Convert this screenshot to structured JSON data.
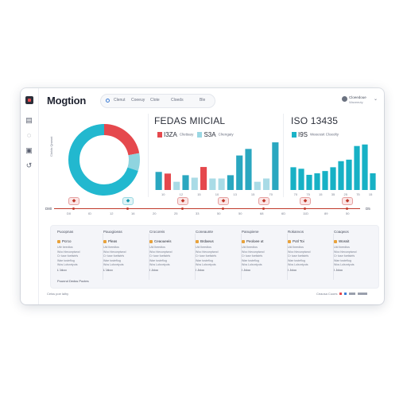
{
  "app": {
    "title": "Mogtion"
  },
  "nav": {
    "tabs": [
      "Clenut",
      "Coeeuy",
      "Clote",
      "Cloeds",
      "Ble"
    ]
  },
  "user": {
    "name": "Cloeedoue",
    "role": "Waveeuty"
  },
  "sidebar": {
    "icons": [
      "calendar-icon",
      "chat-icon",
      "list-icon",
      "link-icon"
    ]
  },
  "donut": {
    "axis_label": "Ctolds Qrawnt",
    "segments": [
      {
        "name": "main",
        "value": 70,
        "color": "#22b8cf"
      },
      {
        "name": "red",
        "value": 22,
        "color": "#e5484d"
      },
      {
        "name": "small",
        "value": 8,
        "color": "#8fd4df"
      }
    ]
  },
  "panel2": {
    "title": "FEDAS MIICIAL",
    "legend": [
      {
        "key": "I3ZA",
        "label": "Cliettauy",
        "color": "#e5484d"
      },
      {
        "key": "S3A",
        "label": "Clrengaiy",
        "color": "#9ad7e3"
      }
    ],
    "ticks": [
      "10",
      "12",
      "15",
      "10",
      "13",
      "15",
      "70"
    ]
  },
  "panel3": {
    "title": "ISO 13435",
    "legend": [
      {
        "key": "I9S",
        "label": "Weeessit Cloeolty",
        "color": "#1bb3c7"
      }
    ],
    "ticks": [
      "70",
      "75",
      "15",
      "35",
      "25",
      "75",
      "15"
    ]
  },
  "timeline": {
    "start": "D80",
    "end": "D5",
    "ticks": [
      "D0",
      "ID",
      "12",
      "16",
      "20",
      "25",
      "33",
      "50",
      "50",
      "68",
      "6D",
      "11D",
      "89",
      "50"
    ]
  },
  "cards": [
    {
      "title": "Puoopnas",
      "badge": "Pcrco",
      "lines": [
        "Uttr beedtos",
        "Woo hlecunptwod",
        "Cr tuse foetlstrfs",
        "Wae tosteflog",
        "Wos Lolsnrtyuts"
      ],
      "foot": "L'Jdoo",
      "extra": "Pounnd Dedss Poctes"
    },
    {
      "title": "Pauogioeas",
      "badge": "Pleas",
      "lines": [
        "Uld lbeedtos",
        "Woo hlecunptwod",
        "Cr tuse foetlstrfs",
        "Wae tosteflog",
        "Wos Lolsnrtyuts"
      ],
      "foot": "L'Jdoo",
      "extra": ""
    },
    {
      "title": "Crocoreis",
      "badge": "Ceaoueeis",
      "lines": [
        "Uld lbeedtos",
        "Woo hlecunptwod",
        "Cr tuse foetlstrfs",
        "Wae tosteflog",
        "Wos Lolsnrtyuts"
      ],
      "foot": "I Jdoo",
      "extra": ""
    },
    {
      "title": "Coneaunte",
      "badge": "Brdaeus",
      "lines": [
        "Uld lbeedtos",
        "Woo hlecunptwod",
        "Cr tuse foetlstrfs",
        "Wae tosteflog",
        "Wos Lolsnrtyuts"
      ],
      "foot": "I Jdoo",
      "extra": ""
    },
    {
      "title": "Panupiene",
      "badge": "Peoloee ut",
      "lines": [
        "Uld lbeedtos",
        "Woo hlecunptwod",
        "Cr tuse foetlstrfs",
        "Wae tosteflog",
        "Wos Lolsnrtyuts"
      ],
      "foot": "I Jdoo",
      "extra": ""
    },
    {
      "title": "Rokanvos",
      "badge": "Potl Toi",
      "lines": [
        "Uld lbeedtos",
        "Woo hlecunptwod",
        "Cr tuse foetlstrfs",
        "Wae tosteflog",
        "Wos Lolsnrtyuts"
      ],
      "foot": "I Jdoo",
      "extra": ""
    },
    {
      "title": "Coaqwos",
      "badge": "Wossit",
      "lines": [
        "Uld lbeedtos",
        "Woo hlecunptwod",
        "Cr tuse foetlstrfs",
        "Wae tosteflog",
        "Wos Lolsnrtyuts"
      ],
      "foot": "I Jdoo",
      "extra": ""
    }
  ],
  "footer": {
    "left": "Ceiss poe lalhy",
    "right": "Ceaosa Cuoes"
  },
  "chart_data": [
    {
      "type": "pie",
      "categories": [
        "main",
        "red",
        "small"
      ],
      "values": [
        70,
        22,
        8
      ]
    },
    {
      "type": "bar",
      "title": "FEDAS MIICIAL",
      "categories": [
        "10",
        "12",
        "15",
        "10",
        "13",
        "15",
        "70"
      ],
      "series": [
        {
          "name": "I3ZA",
          "values": [
            22,
            20,
            0,
            18,
            0,
            28,
            0,
            0,
            18,
            42,
            50,
            0,
            0,
            58
          ]
        },
        {
          "name": "S3A",
          "values": [
            0,
            0,
            10,
            0,
            15,
            0,
            14,
            14,
            0,
            0,
            0,
            10,
            14,
            0
          ]
        }
      ],
      "ylim": [
        0,
        60
      ]
    },
    {
      "type": "bar",
      "title": "ISO 13435",
      "categories": [
        "70",
        "75",
        "15",
        "35",
        "25",
        "75",
        "15"
      ],
      "series": [
        {
          "name": "I9S",
          "values": [
            30,
            28,
            20,
            22,
            25,
            30,
            38,
            40,
            58,
            60,
            22
          ]
        }
      ],
      "ylim": [
        0,
        65
      ]
    }
  ]
}
